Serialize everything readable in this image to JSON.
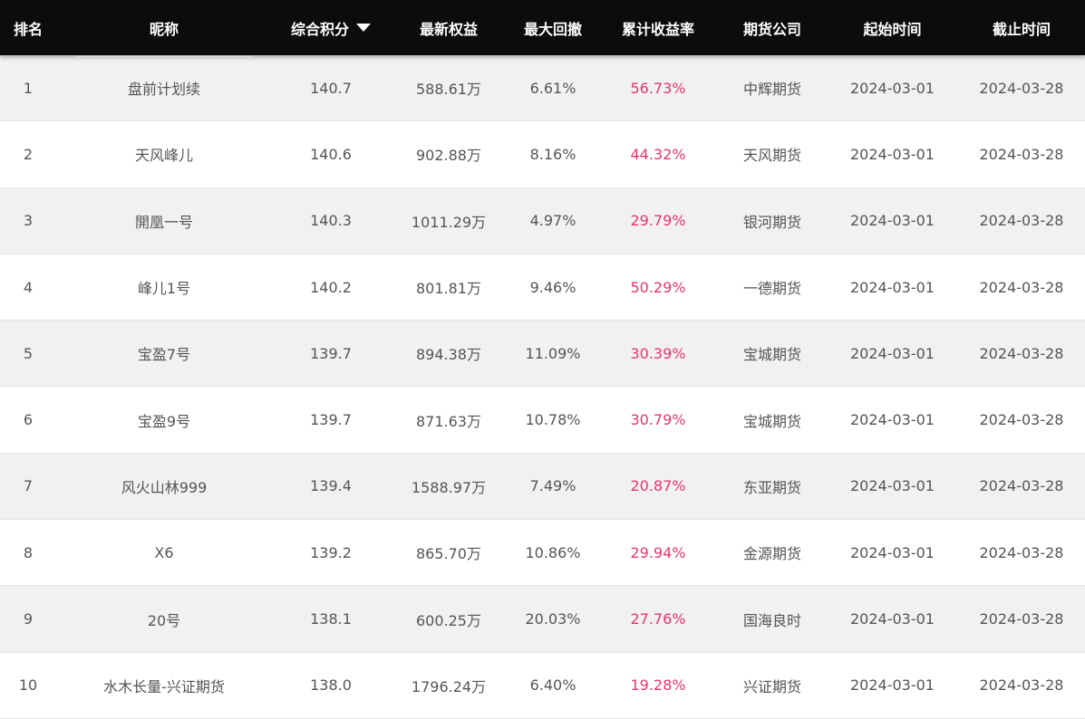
{
  "header": {
    "rank": "排名",
    "nickname": "昵称",
    "score": "综合积分",
    "equity": "最新权益",
    "drawdown": "最大回撤",
    "return_rate": "累计收益率",
    "company": "期货公司",
    "start": "起始时间",
    "end": "截止时间",
    "sort_icon": "caret-down-icon"
  },
  "colors": {
    "header_bg": "#0c0c0c",
    "odd_row_bg": "#f1f1f1",
    "even_row_bg": "#ffffff",
    "return_rate_color": "#e8356d",
    "text_color": "#555555"
  },
  "rows": [
    {
      "rank": "1",
      "nickname": "盘前计划续",
      "score": "140.7",
      "equity": "588.61万",
      "drawdown": "6.61%",
      "return_rate": "56.73%",
      "company": "中辉期货",
      "start": "2024-03-01",
      "end": "2024-03-28"
    },
    {
      "rank": "2",
      "nickname": "天风峰儿",
      "score": "140.6",
      "equity": "902.88万",
      "drawdown": "8.16%",
      "return_rate": "44.32%",
      "company": "天风期货",
      "start": "2024-03-01",
      "end": "2024-03-28"
    },
    {
      "rank": "3",
      "nickname": "開凰一号",
      "score": "140.3",
      "equity": "1011.29万",
      "drawdown": "4.97%",
      "return_rate": "29.79%",
      "company": "银河期货",
      "start": "2024-03-01",
      "end": "2024-03-28"
    },
    {
      "rank": "4",
      "nickname": "峰儿1号",
      "score": "140.2",
      "equity": "801.81万",
      "drawdown": "9.46%",
      "return_rate": "50.29%",
      "company": "一德期货",
      "start": "2024-03-01",
      "end": "2024-03-28"
    },
    {
      "rank": "5",
      "nickname": "宝盈7号",
      "score": "139.7",
      "equity": "894.38万",
      "drawdown": "11.09%",
      "return_rate": "30.39%",
      "company": "宝城期货",
      "start": "2024-03-01",
      "end": "2024-03-28"
    },
    {
      "rank": "6",
      "nickname": "宝盈9号",
      "score": "139.7",
      "equity": "871.63万",
      "drawdown": "10.78%",
      "return_rate": "30.79%",
      "company": "宝城期货",
      "start": "2024-03-01",
      "end": "2024-03-28"
    },
    {
      "rank": "7",
      "nickname": "风火山林999",
      "score": "139.4",
      "equity": "1588.97万",
      "drawdown": "7.49%",
      "return_rate": "20.87%",
      "company": "东亚期货",
      "start": "2024-03-01",
      "end": "2024-03-28"
    },
    {
      "rank": "8",
      "nickname": "X6",
      "score": "139.2",
      "equity": "865.70万",
      "drawdown": "10.86%",
      "return_rate": "29.94%",
      "company": "金源期货",
      "start": "2024-03-01",
      "end": "2024-03-28"
    },
    {
      "rank": "9",
      "nickname": "20号",
      "score": "138.1",
      "equity": "600.25万",
      "drawdown": "20.03%",
      "return_rate": "27.76%",
      "company": "国海良时",
      "start": "2024-03-01",
      "end": "2024-03-28"
    },
    {
      "rank": "10",
      "nickname": "水木长量-兴证期货",
      "score": "138.0",
      "equity": "1796.24万",
      "drawdown": "6.40%",
      "return_rate": "19.28%",
      "company": "兴证期货",
      "start": "2024-03-01",
      "end": "2024-03-28"
    }
  ]
}
